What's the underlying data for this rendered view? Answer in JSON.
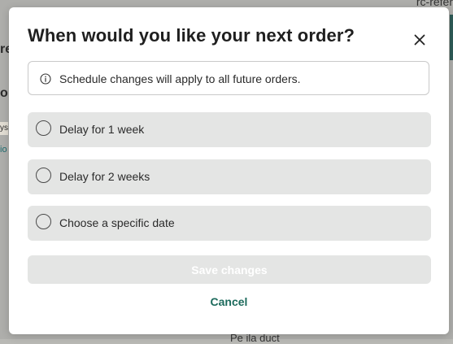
{
  "background": {
    "top_right_text": "rc-refer",
    "left_fragment_1": "re",
    "left_fragment_2": "o",
    "left_fragment_3": "ys",
    "left_fragment_4": "io",
    "bottom_fragment": "Pe       ila    duct"
  },
  "modal": {
    "title": "When would you like your next order?",
    "close_icon": "close-icon",
    "info": {
      "icon": "info-icon",
      "text": "Schedule changes will apply to all future orders."
    },
    "options": [
      {
        "label": "Delay for 1 week",
        "selected": false
      },
      {
        "label": "Delay for 2 weeks",
        "selected": false
      },
      {
        "label": "Choose a specific date",
        "selected": false
      }
    ],
    "save_label": "Save changes",
    "save_enabled": false,
    "cancel_label": "Cancel"
  },
  "colors": {
    "accent": "#1c6a5c",
    "option_bg": "#e4e5e4",
    "backdrop": "#aeaeab"
  }
}
